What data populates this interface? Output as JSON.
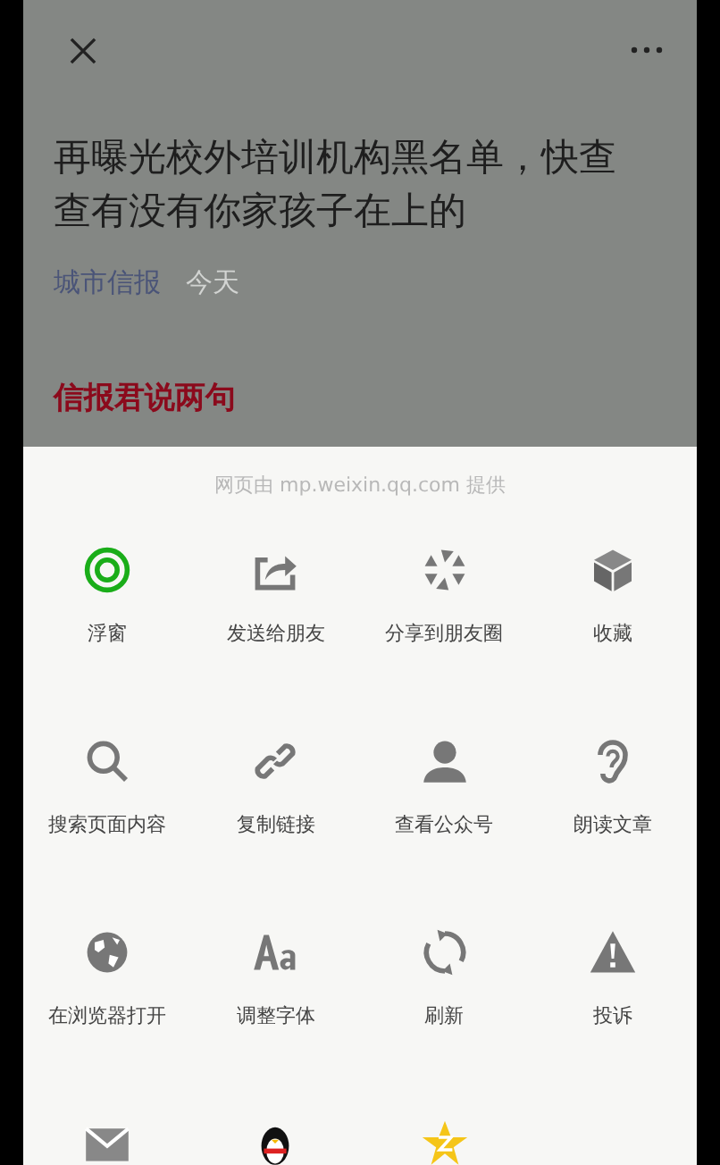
{
  "article": {
    "title": "再曝光校外培训机构黑名单，快查查有没有你家孩子在上的",
    "source": "城市信报",
    "date": "今天",
    "section_heading": "信报君说两句"
  },
  "sheet": {
    "provider": "网页由 mp.weixin.qq.com 提供",
    "items": [
      {
        "kind": "floating",
        "label": "浮窗"
      },
      {
        "kind": "share",
        "label": "发送给朋友"
      },
      {
        "kind": "aperture",
        "label": "分享到朋友圈"
      },
      {
        "kind": "cube",
        "label": "收藏"
      },
      {
        "kind": "search",
        "label": "搜索页面内容"
      },
      {
        "kind": "link",
        "label": "复制链接"
      },
      {
        "kind": "person",
        "label": "查看公众号"
      },
      {
        "kind": "ear",
        "label": "朗读文章"
      },
      {
        "kind": "globe",
        "label": "在浏览器打开"
      },
      {
        "kind": "font",
        "label": "调整字体"
      },
      {
        "kind": "refresh",
        "label": "刷新"
      },
      {
        "kind": "warning",
        "label": "投诉"
      },
      {
        "kind": "mail"
      },
      {
        "kind": "penguin"
      },
      {
        "kind": "star"
      }
    ]
  }
}
